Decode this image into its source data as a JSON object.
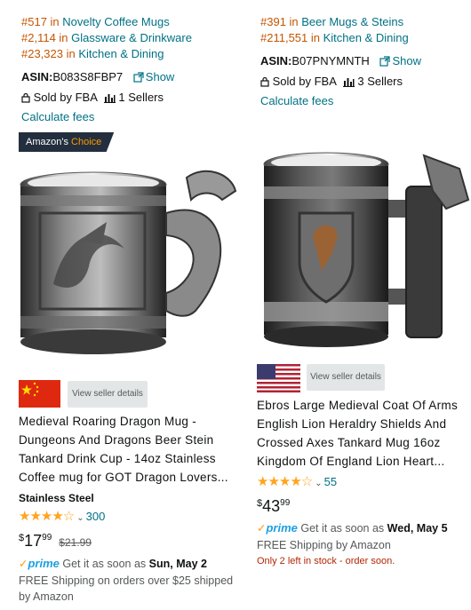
{
  "left": {
    "ranks": [
      {
        "num": "#517",
        "in": " in ",
        "category": "Novelty Coffee Mugs"
      },
      {
        "num": "#2,114",
        "in": " in ",
        "category": "Glassware & Drinkware"
      },
      {
        "num": "#23,323",
        "in": " in ",
        "category": "Kitchen & Dining"
      }
    ],
    "asin_label": "ASIN:",
    "asin": "B083S8FBP7",
    "show_label": "Show",
    "sold_by": "Sold by FBA",
    "sellers": "1 Sellers",
    "calc_fees": "Calculate fees",
    "badge_prefix": "Amazon's",
    "badge_choice": "Choice",
    "view_seller": "View seller details",
    "title": "Medieval Roaring Dragon Mug - Dungeons And Dragons Beer Stein Tankard Drink Cup - 14oz Stainless Coffee mug for GOT Dragon Lovers...",
    "material": "Stainless Steel",
    "rating_count": "300",
    "price_currency": "$",
    "price_whole": "17",
    "price_fraction": "99",
    "list_price": "$21.99",
    "prime_label": "prime",
    "delivery_prefix": "Get it as soon as",
    "delivery_date": "Sun, May 2",
    "shipping": "FREE Shipping on orders over $25 shipped by Amazon"
  },
  "right": {
    "ranks": [
      {
        "num": "#391",
        "in": " in ",
        "category": "Beer Mugs & Steins"
      },
      {
        "num": "#211,551",
        "in": " in ",
        "category": "Kitchen & Dining"
      }
    ],
    "asin_label": "ASIN:",
    "asin": "B07PNYMNTH",
    "show_label": "Show",
    "sold_by": "Sold by FBA",
    "sellers": "3 Sellers",
    "calc_fees": "Calculate fees",
    "view_seller": "View seller details",
    "title": "Ebros Large Medieval Coat Of Arms English Lion Heraldry Shields And Crossed Axes Tankard Mug 16oz Kingdom Of England Lion Heart...",
    "rating_count": "55",
    "price_currency": "$",
    "price_whole": "43",
    "price_fraction": "99",
    "prime_label": "prime",
    "delivery_prefix": "Get it as soon as",
    "delivery_date": "Wed, May 5",
    "shipping": "FREE Shipping by Amazon",
    "stock": "Only 2 left in stock - order soon."
  },
  "colors": {
    "link": "#007185",
    "rank": "#c45500",
    "star": "#ffa41c",
    "prime": "#1aa0e0",
    "stock": "#b12704",
    "badge_bg": "#232f3e"
  },
  "icons": [
    "external-link-icon",
    "lock-icon",
    "bar-chart-icon",
    "star-icon",
    "chevron-down-icon",
    "china-flag-icon",
    "usa-flag-icon"
  ]
}
